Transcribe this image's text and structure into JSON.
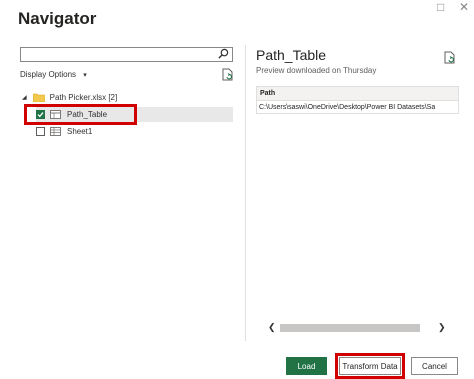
{
  "window": {
    "title": "Navigator",
    "restore_icon": "□",
    "close_icon": "✕"
  },
  "left": {
    "search": {
      "value": "",
      "placeholder": ""
    },
    "display_options_label": "Display Options",
    "display_options_caret": "▾",
    "tree": {
      "root": {
        "label": "Path Picker.xlsx [2]",
        "expanded_glyph": "◢"
      },
      "items": [
        {
          "label": "Path_Table",
          "checked": true
        },
        {
          "label": "Sheet1",
          "checked": false
        }
      ]
    }
  },
  "preview": {
    "title": "Path_Table",
    "subtitle": "Preview downloaded on Thursday",
    "columns": [
      "Path"
    ],
    "rows": [
      [
        "C:\\Users\\saswi\\OneDrive\\Desktop\\Power BI Datasets\\Sa"
      ]
    ],
    "scroll_left": "❮",
    "scroll_right": "❯"
  },
  "footer": {
    "load": "Load",
    "transform": "Transform Data",
    "cancel": "Cancel"
  },
  "colors": {
    "accent": "#217346",
    "highlight": "#d00000"
  }
}
